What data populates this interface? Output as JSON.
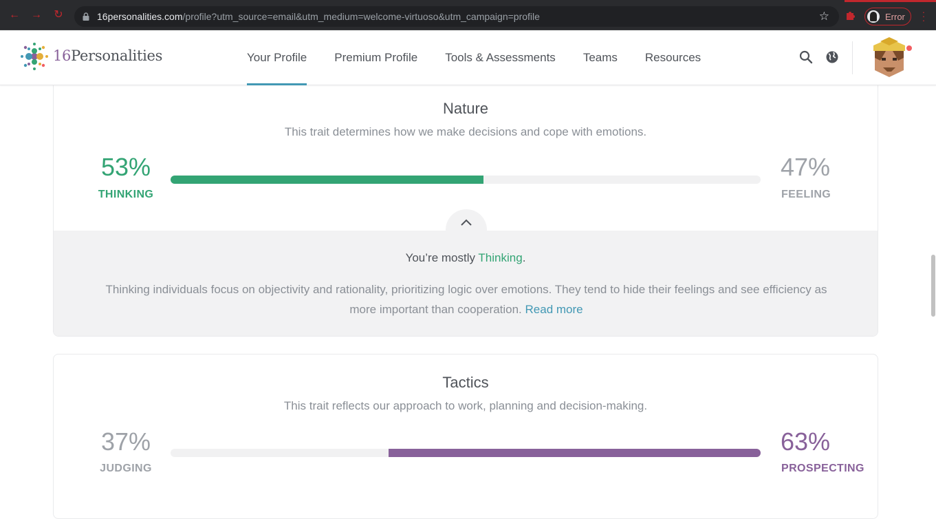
{
  "browser": {
    "host": "16personalities.com",
    "path": "/profile?utm_source=email&utm_medium=welcome-virtuoso&utm_campaign=profile",
    "error_label": "Error"
  },
  "header": {
    "logo_num": "16",
    "logo_word": "Personalities",
    "nav": [
      {
        "label": "Your Profile",
        "active": true
      },
      {
        "label": "Premium Profile",
        "active": false
      },
      {
        "label": "Tools & Assessments",
        "active": false
      },
      {
        "label": "Teams",
        "active": false
      },
      {
        "label": "Resources",
        "active": false
      }
    ]
  },
  "nature": {
    "title": "Nature",
    "description": "This trait determines how we make decisions and cope with emotions.",
    "left_pct": "53%",
    "left_label": "THINKING",
    "right_pct": "47%",
    "right_label": "FEELING",
    "left_fraction": 0.53,
    "mostly_prefix": "You’re mostly ",
    "mostly_trait": "Thinking",
    "mostly_suffix": ".",
    "explanation": "Thinking individuals focus on objectivity and rationality, prioritizing logic over emotions. They tend to hide their feelings and see efficiency as more important than cooperation.",
    "read_more": "Read more",
    "accent": "#33a474"
  },
  "tactics": {
    "title": "Tactics",
    "description": "This trait reflects our approach to work, planning and decision-making.",
    "left_pct": "37%",
    "left_label": "JUDGING",
    "right_pct": "63%",
    "right_label": "PROSPECTING",
    "right_fraction": 0.63,
    "accent": "#88619a"
  }
}
